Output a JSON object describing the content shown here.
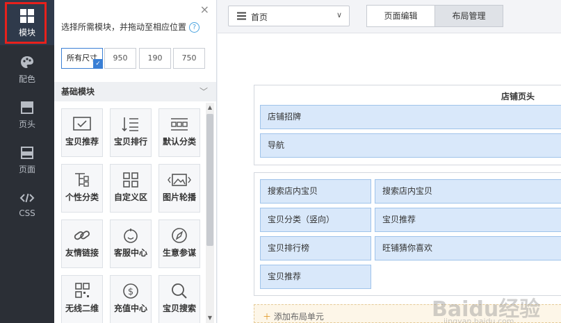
{
  "rail": {
    "items": [
      {
        "label": "模块",
        "icon": "grid-icon"
      },
      {
        "label": "配色",
        "icon": "palette-icon"
      },
      {
        "label": "页头",
        "icon": "header-icon"
      },
      {
        "label": "页面",
        "icon": "page-icon"
      },
      {
        "label": "CSS",
        "icon": "code-icon"
      }
    ]
  },
  "panel": {
    "close": "×",
    "hint": "选择所需模块，并拖动至相应位置",
    "help": "?",
    "sizes": [
      "所有尺寸",
      "950",
      "190",
      "750"
    ],
    "section_title": "基础模块",
    "section_chevron": "﹀",
    "tiles": [
      {
        "name": "宝贝推荐",
        "icon": "recommend-icon"
      },
      {
        "name": "宝贝排行",
        "icon": "ranking-icon"
      },
      {
        "name": "默认分类",
        "icon": "default-category-icon"
      },
      {
        "name": "个性分类",
        "icon": "custom-category-icon"
      },
      {
        "name": "自定义区",
        "icon": "custom-area-icon"
      },
      {
        "name": "图片轮播",
        "icon": "carousel-icon"
      },
      {
        "name": "友情链接",
        "icon": "link-icon"
      },
      {
        "name": "客服中心",
        "icon": "service-icon"
      },
      {
        "name": "生意参谋",
        "icon": "compass-icon"
      },
      {
        "name": "无线二维",
        "icon": "qrcode-icon"
      },
      {
        "name": "充值中心",
        "icon": "recharge-icon"
      },
      {
        "name": "宝贝搜索",
        "icon": "search-icon"
      }
    ]
  },
  "topbar": {
    "page_select": "首页",
    "tabs": [
      "页面编辑",
      "布局管理"
    ],
    "active_tab": "布局管理"
  },
  "canvas": {
    "header_block": {
      "title": "店铺页头",
      "rows": [
        "店铺招牌",
        "导航"
      ]
    },
    "body_block": {
      "left": [
        "搜索店内宝贝",
        "宝贝分类（竖向）",
        "宝贝排行榜",
        "宝贝推荐"
      ],
      "right": [
        "搜索店内宝贝",
        "宝贝推荐",
        "旺铺猜你喜欢"
      ]
    },
    "add_layout": "添加布局单元"
  },
  "watermark": {
    "main": "Baidu经验",
    "sub": "jingyan.baidu.com"
  }
}
